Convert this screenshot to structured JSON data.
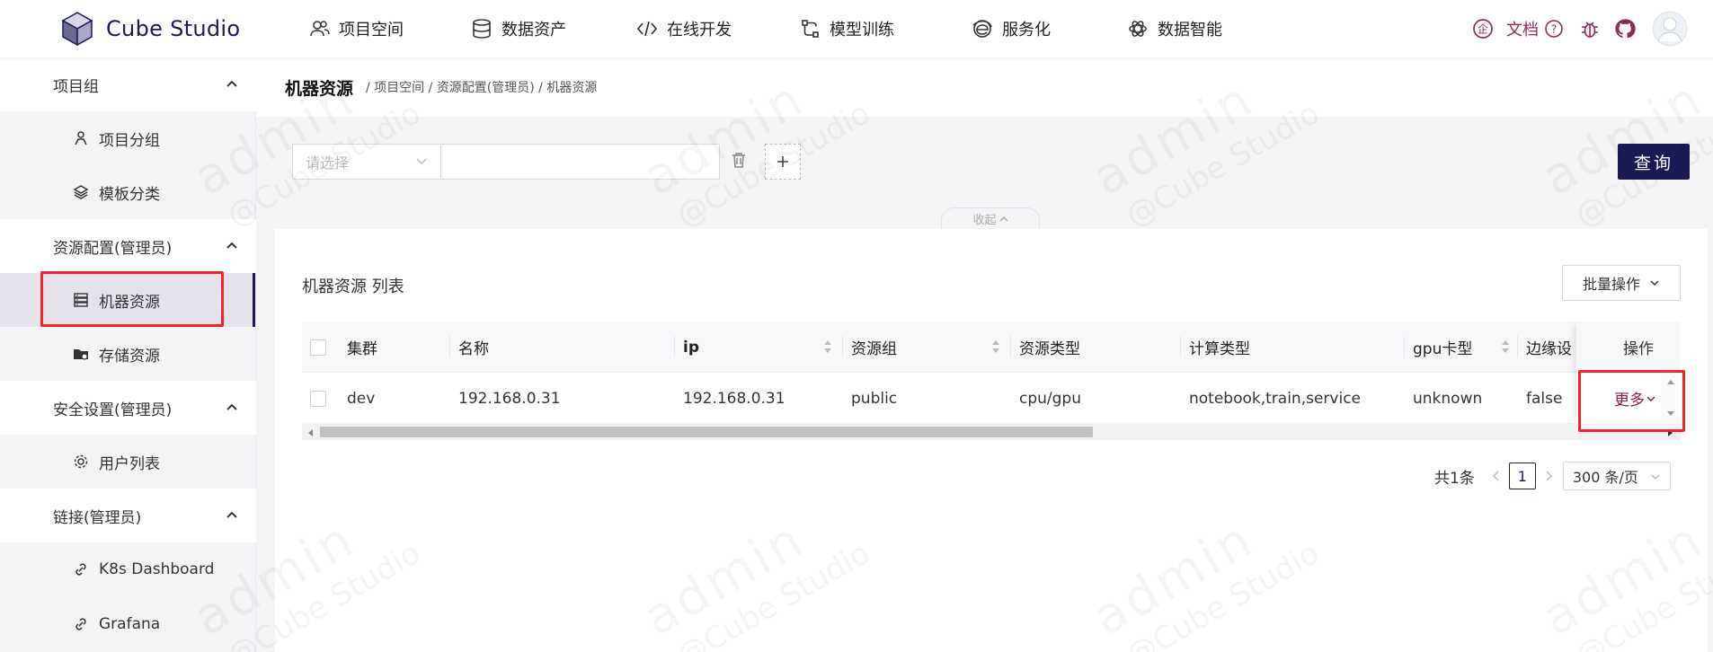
{
  "app": {
    "title": "Cube Studio"
  },
  "nav": [
    {
      "label": "项目空间",
      "icon": "users-icon"
    },
    {
      "label": "数据资产",
      "icon": "database-icon"
    },
    {
      "label": "在线开发",
      "icon": "code-icon"
    },
    {
      "label": "模型训练",
      "icon": "model-icon"
    },
    {
      "label": "服务化",
      "icon": "globe-icon"
    },
    {
      "label": "数据智能",
      "icon": "openai-icon"
    }
  ],
  "header_right": {
    "docs_label": "文档"
  },
  "sidebar": {
    "groups": [
      {
        "label": "项目组",
        "items": [
          {
            "label": "项目分组"
          },
          {
            "label": "模板分类"
          }
        ]
      },
      {
        "label": "资源配置(管理员)",
        "items": [
          {
            "label": "机器资源"
          },
          {
            "label": "存储资源"
          }
        ]
      },
      {
        "label": "安全设置(管理员)",
        "items": [
          {
            "label": "用户列表"
          }
        ]
      },
      {
        "label": "链接(管理员)",
        "items": [
          {
            "label": "K8s Dashboard"
          },
          {
            "label": "Grafana"
          }
        ]
      }
    ]
  },
  "breadcrumb": {
    "title": "机器资源",
    "path": "/ 项目空间 / 资源配置(管理员) / 机器资源"
  },
  "filter": {
    "select_placeholder": "请选择",
    "query_label": "查询",
    "collapse_label": "收起"
  },
  "list": {
    "title": "机器资源 列表",
    "batch_label": "批量操作",
    "columns": [
      "集群",
      "名称",
      "ip",
      "资源组",
      "资源类型",
      "计算类型",
      "gpu卡型",
      "边缘设",
      "操作"
    ],
    "rows": [
      {
        "cluster": "dev",
        "name": "192.168.0.31",
        "ip": "192.168.0.31",
        "group": "public",
        "res_type": "cpu/gpu",
        "compute_type": "notebook,train,service",
        "gpu_type": "unknown",
        "edge": "false",
        "action": "更多"
      }
    ]
  },
  "pagination": {
    "total_label": "共1条",
    "current_page": "1",
    "page_size_label": "300 条/页"
  },
  "watermark": {
    "user": "admin",
    "brand": "@Cube Studio"
  },
  "colors": {
    "brand": "#1b1a55",
    "accent": "#8b1b4f",
    "highlight": "#f2242a"
  }
}
